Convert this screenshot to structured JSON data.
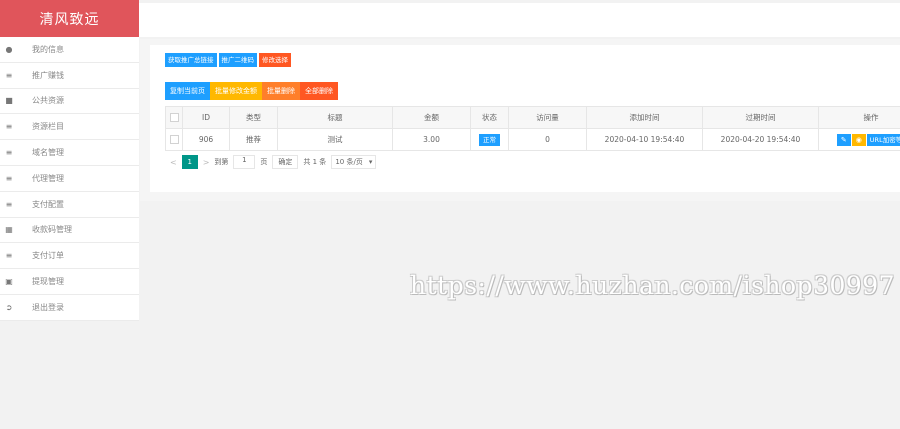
{
  "brand": "清风致远",
  "sidebar": {
    "items": [
      {
        "label": "我的信息",
        "icon": "user-icon"
      },
      {
        "label": "推广赚钱",
        "icon": "list-icon"
      },
      {
        "label": "公共资源",
        "icon": "video-icon"
      },
      {
        "label": "资源栏目",
        "icon": "list-icon"
      },
      {
        "label": "域名管理",
        "icon": "list-icon"
      },
      {
        "label": "代理管理",
        "icon": "list-icon"
      },
      {
        "label": "支付配置",
        "icon": "list-icon"
      },
      {
        "label": "收款码管理",
        "icon": "qrcode-icon"
      },
      {
        "label": "支付订单",
        "icon": "list-icon"
      },
      {
        "label": "提现管理",
        "icon": "money-icon"
      },
      {
        "label": "退出登录",
        "icon": "logout-icon"
      }
    ]
  },
  "toolbar1": {
    "get_link": "获取推广总链接",
    "qrcode": "推广二维码",
    "edit_selected": "修改选择"
  },
  "toolbar2": {
    "copy_page": "复制当前页",
    "batch_edit": "批量修改金额",
    "batch_delete": "批量删除",
    "delete_all": "全部删除"
  },
  "table": {
    "headers": [
      "ID",
      "类型",
      "标题",
      "金额",
      "状态",
      "访问量",
      "添加时间",
      "过期时间",
      "操作"
    ],
    "rows": [
      {
        "id": "906",
        "type": "推荐",
        "title": "测试",
        "amount": "3.00",
        "status": "正常",
        "views": "0",
        "added": "2020-04-10 19:54:40",
        "expires": "2020-04-20 19:54:40",
        "url_label": "URL加密等"
      }
    ]
  },
  "pager": {
    "current": "1",
    "goto_label": "到第",
    "page_input": "1",
    "page_label": "页",
    "confirm": "确定",
    "total": "共 1 条",
    "page_size": "10 条/页"
  },
  "watermark": "https://www.huzhan.com/ishop30997",
  "colors": {
    "brand": "#e0555b",
    "blue": "#1e9fff",
    "orange": "#ff7f2a",
    "yellow": "#ffb800",
    "red": "#ff5722",
    "teal": "#009688"
  }
}
